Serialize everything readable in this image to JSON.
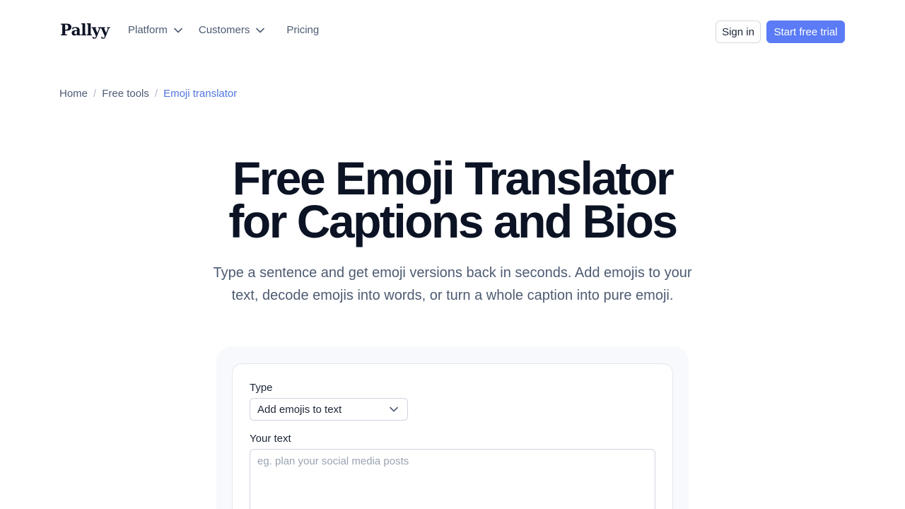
{
  "brand": {
    "logo": "Pallyy"
  },
  "nav": {
    "platform": "Platform",
    "customers": "Customers",
    "pricing": "Pricing",
    "sign_in": "Sign in",
    "start_trial": "Start free trial"
  },
  "breadcrumb": {
    "home": "Home",
    "free_tools": "Free tools",
    "current": "Emoji translator"
  },
  "hero": {
    "title_line1": "Free Emoji Translator",
    "title_line2": "for Captions and Bios",
    "subtitle_line1": "Type a sentence and get emoji versions back in seconds. Add emojis to your",
    "subtitle_line2": "text, decode emojis into words, or turn a whole caption into pure emoji."
  },
  "form": {
    "type_label": "Type",
    "type_value": "Add emojis to text",
    "text_label": "Your text",
    "text_placeholder": "eg. plan your social media posts",
    "text_value": ""
  },
  "colors": {
    "accent": "#5b7cf6",
    "link_active": "#4f75e0",
    "heading": "#0b1324",
    "muted": "#4d5b72"
  },
  "icons": {
    "dropdown": "chevron-down-icon"
  }
}
